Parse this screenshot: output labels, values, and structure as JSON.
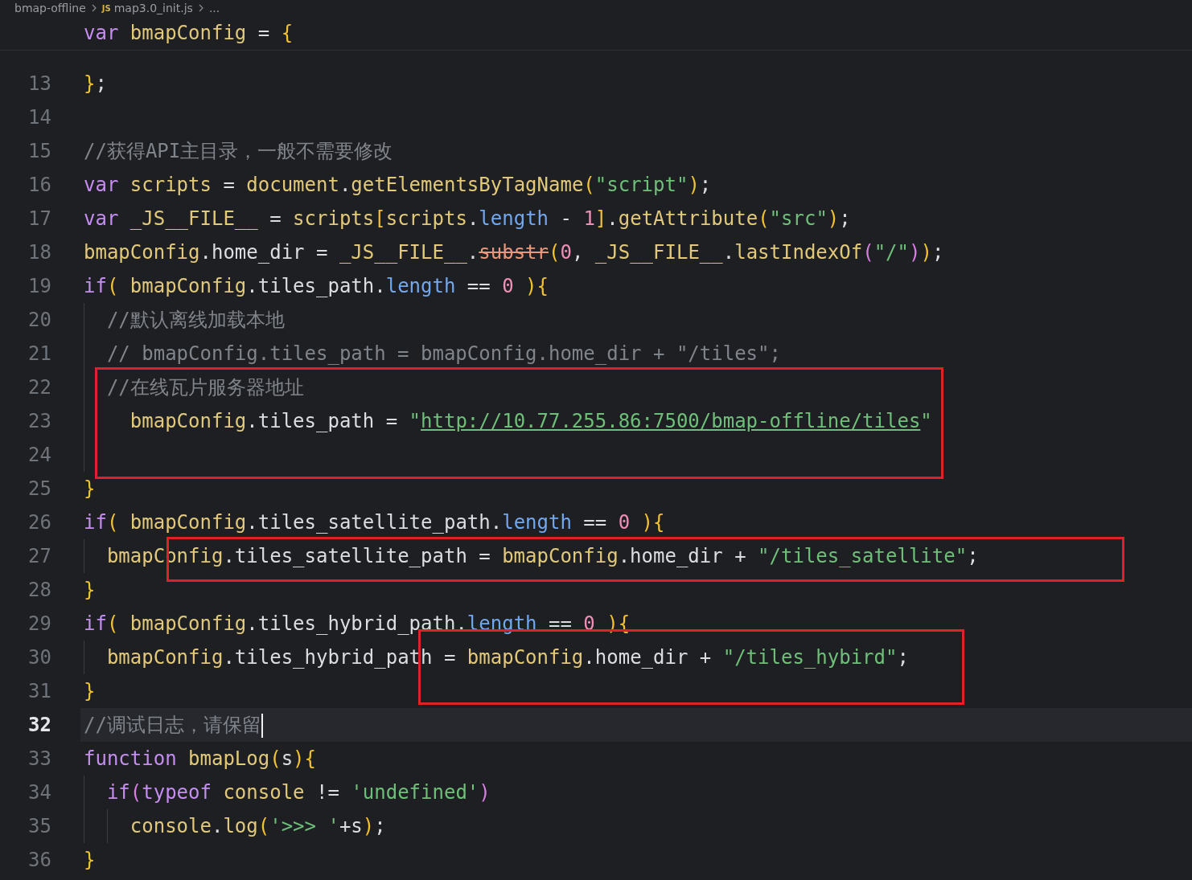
{
  "breadcrumb": [
    {
      "text": "bmap-offline",
      "kind": "folder"
    },
    {
      "text": "map3.0_init.js",
      "kind": "js-file",
      "icon_text": "JS"
    },
    {
      "text": "...",
      "kind": "more"
    }
  ],
  "sticky_line": [
    {
      "text": "var",
      "kind": "keyword"
    },
    {
      "text": " bmapConfig",
      "kind": "ident"
    },
    {
      "text": " = ",
      "kind": "plain"
    },
    {
      "text": "{",
      "kind": "bracket"
    }
  ],
  "lines": [
    {
      "number": "13",
      "current": false,
      "tokens": [
        {
          "text": "}",
          "kind": "bracket"
        },
        {
          "text": ";",
          "kind": "plain"
        }
      ]
    },
    {
      "number": "14",
      "current": false
    },
    {
      "number": "15",
      "current": false,
      "tokens": [
        {
          "text": "//获得API主目录，一般不需要修改",
          "kind": "comment"
        }
      ]
    },
    {
      "number": "16",
      "current": false,
      "tokens": [
        {
          "text": "var",
          "kind": "keyword"
        },
        {
          "text": " scripts",
          "kind": "ident"
        },
        {
          "text": " = ",
          "kind": "plain"
        },
        {
          "text": "document",
          "kind": "ident"
        },
        {
          "text": ".",
          "kind": "plain"
        },
        {
          "text": "getElementsByTagName",
          "kind": "ident"
        },
        {
          "text": "(",
          "kind": "bracket"
        },
        {
          "text": "\"script\"",
          "kind": "string"
        },
        {
          "text": ")",
          "kind": "bracket"
        },
        {
          "text": ";",
          "kind": "plain"
        }
      ]
    },
    {
      "number": "17",
      "current": false,
      "tokens": [
        {
          "text": "var",
          "kind": "keyword"
        },
        {
          "text": " _JS__FILE__",
          "kind": "ident"
        },
        {
          "text": " = ",
          "kind": "plain"
        },
        {
          "text": "scripts",
          "kind": "ident"
        },
        {
          "text": "[",
          "kind": "bracket"
        },
        {
          "text": "scripts",
          "kind": "ident"
        },
        {
          "text": ".",
          "kind": "plain"
        },
        {
          "text": "length",
          "kind": "builtin"
        },
        {
          "text": " - ",
          "kind": "plain"
        },
        {
          "text": "1",
          "kind": "number"
        },
        {
          "text": "]",
          "kind": "bracket"
        },
        {
          "text": ".",
          "kind": "plain"
        },
        {
          "text": "getAttribute",
          "kind": "ident"
        },
        {
          "text": "(",
          "kind": "bracket"
        },
        {
          "text": "\"src\"",
          "kind": "string"
        },
        {
          "text": ")",
          "kind": "bracket"
        },
        {
          "text": ";",
          "kind": "plain"
        }
      ]
    },
    {
      "number": "18",
      "current": false,
      "tokens": [
        {
          "text": "bmapConfig",
          "kind": "ident"
        },
        {
          "text": ".home_dir = ",
          "kind": "plain"
        },
        {
          "text": "_JS__FILE__",
          "kind": "ident"
        },
        {
          "text": ".",
          "kind": "plain"
        },
        {
          "text": "substr",
          "kind": "deprecated"
        },
        {
          "text": "(",
          "kind": "bracket"
        },
        {
          "text": "0",
          "kind": "number"
        },
        {
          "text": ", ",
          "kind": "plain"
        },
        {
          "text": "_JS__FILE__",
          "kind": "ident"
        },
        {
          "text": ".",
          "kind": "plain"
        },
        {
          "text": "lastIndexOf",
          "kind": "ident"
        },
        {
          "text": "(",
          "kind": "bracket2"
        },
        {
          "text": "\"/\"",
          "kind": "string"
        },
        {
          "text": ")",
          "kind": "bracket2"
        },
        {
          "text": ")",
          "kind": "bracket"
        },
        {
          "text": ";",
          "kind": "plain"
        }
      ]
    },
    {
      "number": "19",
      "current": false,
      "tokens": [
        {
          "text": "if",
          "kind": "keyword"
        },
        {
          "text": "(",
          "kind": "bracket"
        },
        {
          "text": " bmapConfig",
          "kind": "ident"
        },
        {
          "text": ".tiles_path.",
          "kind": "plain"
        },
        {
          "text": "length",
          "kind": "builtin"
        },
        {
          "text": " == ",
          "kind": "plain"
        },
        {
          "text": "0",
          "kind": "number"
        },
        {
          "text": " ){",
          "kind": "bracket"
        }
      ]
    },
    {
      "number": "20",
      "current": false,
      "indent": [
        {
          "kind": "guide"
        }
      ],
      "tokens": [
        {
          "text": "//默认离线加载本地",
          "kind": "comment"
        }
      ]
    },
    {
      "number": "21",
      "current": false,
      "indent": [
        {
          "kind": "guide"
        }
      ],
      "tokens": [
        {
          "text": "// bmapConfig.tiles_path = bmapConfig.home_dir + \"/tiles\";",
          "kind": "comment"
        }
      ]
    },
    {
      "number": "22",
      "current": false,
      "indent": [
        {
          "kind": "guide"
        }
      ],
      "tokens": [
        {
          "text": "//在线瓦片服务器地址",
          "kind": "comment"
        }
      ]
    },
    {
      "number": "23",
      "current": false,
      "indent": [
        {
          "kind": "guide"
        },
        {
          "kind": "blank"
        }
      ],
      "tokens": [
        {
          "text": "bmapConfig",
          "kind": "ident"
        },
        {
          "text": ".tiles_path = ",
          "kind": "plain"
        },
        {
          "text": "\"",
          "kind": "string"
        },
        {
          "text": "http://10.77.255.86:7500/bmap-offline/tiles",
          "kind": "link"
        },
        {
          "text": "\"",
          "kind": "string"
        }
      ]
    },
    {
      "number": "24",
      "current": false,
      "indent": [
        {
          "kind": "guide"
        }
      ]
    },
    {
      "number": "25",
      "current": false,
      "tokens": [
        {
          "text": "}",
          "kind": "bracket"
        }
      ]
    },
    {
      "number": "26",
      "current": false,
      "tokens": [
        {
          "text": "if",
          "kind": "keyword"
        },
        {
          "text": "(",
          "kind": "bracket"
        },
        {
          "text": " bmapConfig",
          "kind": "ident"
        },
        {
          "text": ".tiles_satellite_path.",
          "kind": "plain"
        },
        {
          "text": "length",
          "kind": "builtin"
        },
        {
          "text": " == ",
          "kind": "plain"
        },
        {
          "text": "0",
          "kind": "number"
        },
        {
          "text": " ){",
          "kind": "bracket"
        }
      ]
    },
    {
      "number": "27",
      "current": false,
      "indent": [
        {
          "kind": "guide"
        }
      ],
      "tokens": [
        {
          "text": "bmapConfig",
          "kind": "ident"
        },
        {
          "text": ".tiles_satellite_path = ",
          "kind": "plain"
        },
        {
          "text": "bmapConfig",
          "kind": "ident"
        },
        {
          "text": ".home_dir + ",
          "kind": "plain"
        },
        {
          "text": "\"/tiles_satellite\"",
          "kind": "string"
        },
        {
          "text": ";",
          "kind": "plain"
        }
      ]
    },
    {
      "number": "28",
      "current": false,
      "tokens": [
        {
          "text": "}",
          "kind": "bracket"
        }
      ]
    },
    {
      "number": "29",
      "current": false,
      "tokens": [
        {
          "text": "if",
          "kind": "keyword"
        },
        {
          "text": "(",
          "kind": "bracket"
        },
        {
          "text": " bmapConfig",
          "kind": "ident"
        },
        {
          "text": ".tiles_hybrid_path.",
          "kind": "plain"
        },
        {
          "text": "length",
          "kind": "builtin"
        },
        {
          "text": " == ",
          "kind": "plain"
        },
        {
          "text": "0",
          "kind": "number"
        },
        {
          "text": " ){",
          "kind": "bracket"
        }
      ]
    },
    {
      "number": "30",
      "current": false,
      "indent": [
        {
          "kind": "guide"
        }
      ],
      "tokens": [
        {
          "text": "bmapConfig",
          "kind": "ident"
        },
        {
          "text": ".tiles_hybrid_path = ",
          "kind": "plain"
        },
        {
          "text": "bmapConfig",
          "kind": "ident"
        },
        {
          "text": ".home_dir + ",
          "kind": "plain"
        },
        {
          "text": "\"/tiles_hybird\"",
          "kind": "string"
        },
        {
          "text": ";",
          "kind": "plain"
        }
      ]
    },
    {
      "number": "31",
      "current": false,
      "tokens": [
        {
          "text": "}",
          "kind": "bracket"
        }
      ]
    },
    {
      "number": "32",
      "current": true,
      "tokens": [
        {
          "text": "//调试日志，请保留",
          "kind": "comment"
        }
      ]
    },
    {
      "number": "33",
      "current": false,
      "tokens": [
        {
          "text": "function",
          "kind": "keyword"
        },
        {
          "text": " bmapLog",
          "kind": "ident"
        },
        {
          "text": "(",
          "kind": "bracket"
        },
        {
          "text": "s",
          "kind": "plain"
        },
        {
          "text": "){",
          "kind": "bracket"
        }
      ]
    },
    {
      "number": "34",
      "current": false,
      "indent": [
        {
          "kind": "guide"
        }
      ],
      "tokens": [
        {
          "text": "if",
          "kind": "keyword"
        },
        {
          "text": "(",
          "kind": "bracket2"
        },
        {
          "text": "typeof",
          "kind": "keyword"
        },
        {
          "text": " console",
          "kind": "ident"
        },
        {
          "text": " != ",
          "kind": "plain"
        },
        {
          "text": "'undefined'",
          "kind": "string"
        },
        {
          "text": ")",
          "kind": "bracket2"
        }
      ]
    },
    {
      "number": "35",
      "current": false,
      "indent": [
        {
          "kind": "guide"
        },
        {
          "kind": "guide"
        }
      ],
      "tokens": [
        {
          "text": "console",
          "kind": "ident"
        },
        {
          "text": ".",
          "kind": "plain"
        },
        {
          "text": "log",
          "kind": "ident"
        },
        {
          "text": "(",
          "kind": "bracket"
        },
        {
          "text": "'>>> '",
          "kind": "string"
        },
        {
          "text": "+s",
          "kind": "plain"
        },
        {
          "text": ")",
          "kind": "bracket"
        },
        {
          "text": ";",
          "kind": "plain"
        }
      ]
    },
    {
      "number": "36",
      "current": false,
      "tokens": [
        {
          "text": "}",
          "kind": "bracket"
        }
      ]
    }
  ]
}
